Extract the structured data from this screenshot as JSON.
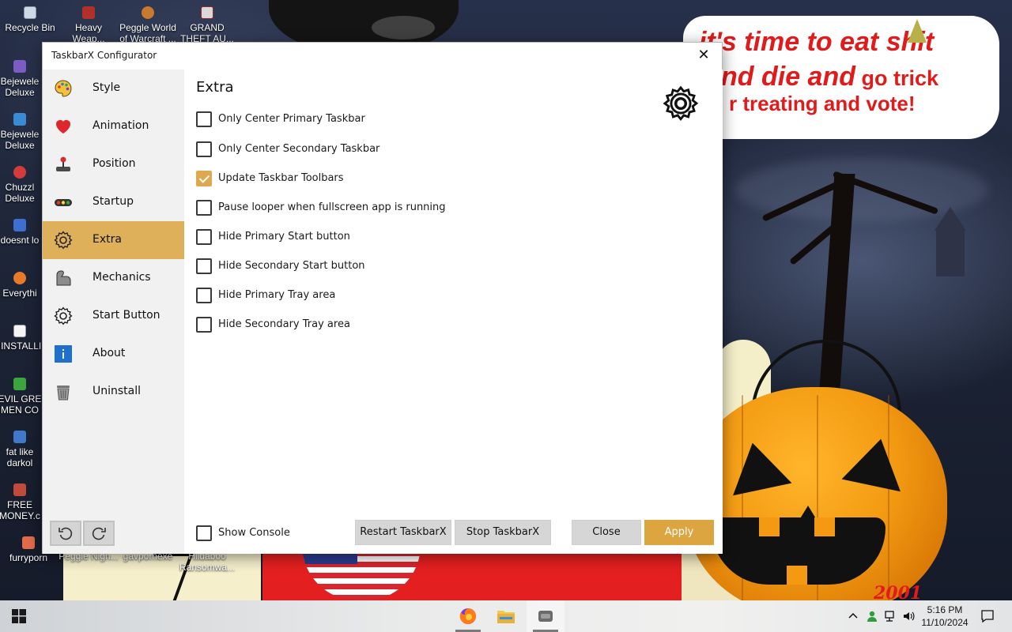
{
  "window": {
    "title": "TaskbarX Configurator",
    "close_glyph": "✕"
  },
  "sidebar": {
    "items": [
      {
        "label": "Style",
        "icon": "palette-icon"
      },
      {
        "label": "Animation",
        "icon": "heart-icon"
      },
      {
        "label": "Position",
        "icon": "joystick-icon"
      },
      {
        "label": "Startup",
        "icon": "traffic-light-icon"
      },
      {
        "label": "Extra",
        "icon": "gear-icon",
        "active": true
      },
      {
        "label": "Mechanics",
        "icon": "arm-icon"
      },
      {
        "label": "Start Button",
        "icon": "gear-icon"
      },
      {
        "label": "About",
        "icon": "info-icon"
      },
      {
        "label": "Uninstall",
        "icon": "trash-icon"
      }
    ]
  },
  "content": {
    "title": "Extra",
    "options": [
      {
        "label": "Only Center Primary Taskbar",
        "checked": false
      },
      {
        "label": "Only Center Secondary Taskbar",
        "checked": false
      },
      {
        "label": "Update Taskbar Toolbars",
        "checked": true
      },
      {
        "label": "Pause looper when fullscreen app is running",
        "checked": false
      },
      {
        "label": "Hide Primary Start button",
        "checked": false
      },
      {
        "label": "Hide Secondary Start button",
        "checked": false
      },
      {
        "label": "Hide Primary Tray area",
        "checked": false
      },
      {
        "label": "Hide Secondary Tray area",
        "checked": false
      }
    ]
  },
  "footer": {
    "show_console": "Show Console",
    "show_console_checked": false,
    "restart": "Restart TaskbarX",
    "stop": "Stop TaskbarX",
    "close": "Close",
    "apply": "Apply"
  },
  "desktop": {
    "icons": [
      {
        "label": "Recycle Bin"
      },
      {
        "label": "Heavy Weap..."
      },
      {
        "label": "Peggle World of Warcraft ..."
      },
      {
        "label": "GRAND THEFT AU..."
      },
      {
        "label": "Bejewele Deluxe"
      },
      {
        "label": "Bejewele Deluxe"
      },
      {
        "label": "Chuzzl Deluxe"
      },
      {
        "label": "doesnt lo"
      },
      {
        "label": "Everythi"
      },
      {
        "label": "!INSTALLI"
      },
      {
        "label": "EVIL GRE MEN CO"
      },
      {
        "label": "fat like darkol"
      },
      {
        "label": "FREE MONEY.c"
      },
      {
        "label": "furryporn"
      },
      {
        "label": "Peggle Nigh..."
      },
      {
        "label": "gavpornexe"
      },
      {
        "label": "Hildaboo Ransomwa..."
      }
    ],
    "bubble": {
      "line1": "it's time to eat shit",
      "line2_italic": "nd die and",
      "line2_plain": " go trick",
      "line3": "r treating and vote!"
    },
    "sticker": "2001"
  },
  "taskbar": {
    "time": "5:16 PM",
    "date": "11/10/2024"
  },
  "colors": {
    "accent": "#dfb05a",
    "apply": "#dca53f",
    "checkbox_checked": "#dfa84d"
  }
}
